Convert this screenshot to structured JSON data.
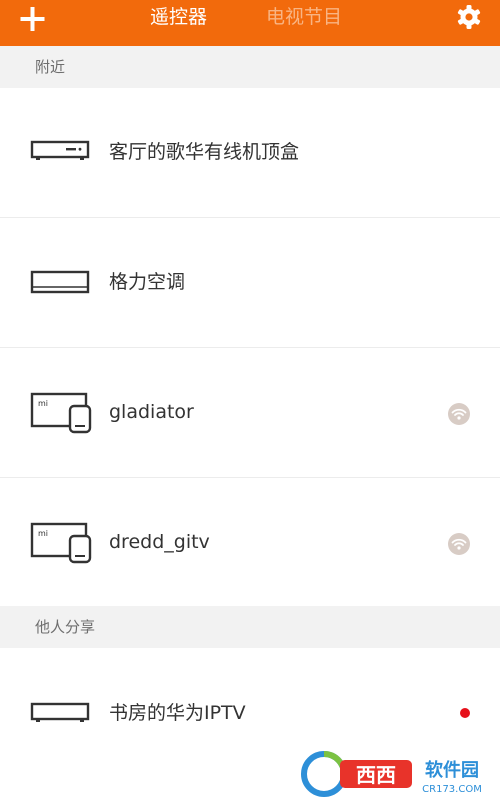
{
  "header": {
    "tabs": [
      {
        "label": "遥控器",
        "active": true
      },
      {
        "label": "电视节目",
        "active": false
      }
    ],
    "add_icon": "plus-icon",
    "settings_icon": "gear-icon",
    "background_color": "#f26a0c"
  },
  "sections": {
    "nearby": {
      "label": "附近",
      "devices": [
        {
          "name": "客厅的歌华有线机顶盒",
          "icon": "set-top-box-icon"
        },
        {
          "name": "格力空调",
          "icon": "air-conditioner-icon"
        },
        {
          "name": "gladiator",
          "icon": "mi-tv-with-box-icon",
          "status_icon": "wifi-icon"
        },
        {
          "name": "dredd_gitv",
          "icon": "mi-tv-with-box-icon",
          "status_icon": "wifi-icon"
        }
      ]
    },
    "shared": {
      "label": "他人分享",
      "devices": [
        {
          "name": "书房的华为IPTV",
          "icon": "iptv-box-icon",
          "status_icon": "red-dot-indicator"
        }
      ]
    }
  },
  "watermark": {
    "text": "西西软件园",
    "url_text": "CR173.COM"
  }
}
